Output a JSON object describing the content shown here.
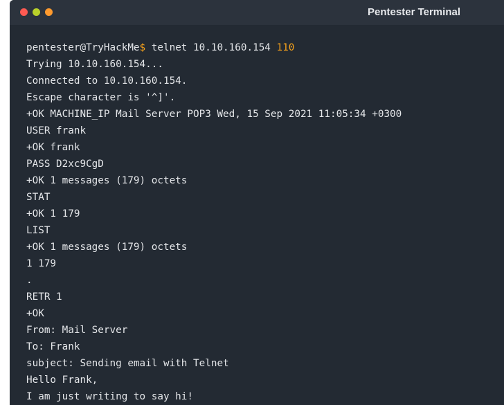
{
  "window": {
    "title": "Pentester Terminal",
    "controls": [
      "close",
      "minimize",
      "maximize"
    ]
  },
  "colors": {
    "background": "#232a33",
    "titlebar": "#2c333d",
    "text": "#e4e6e9",
    "accent": "#f7a21b",
    "close": "#ff5a52",
    "minimize": "#b9d12a",
    "maximize": "#ff9a2e"
  },
  "prompt": {
    "user_host": "pentester@TryHackMe",
    "symbol": "$",
    "command": " telnet 10.10.160.154 ",
    "port": "110"
  },
  "output": [
    "Trying 10.10.160.154...",
    "Connected to 10.10.160.154.",
    "Escape character is '^]'.",
    "+OK MACHINE_IP Mail Server POP3 Wed, 15 Sep 2021 11:05:34 +0300",
    "USER frank",
    "+OK frank",
    "PASS D2xc9CgD",
    "+OK 1 messages (179) octets",
    "STAT",
    "+OK 1 179",
    "LIST",
    "+OK 1 messages (179) octets",
    "1 179",
    ".",
    "RETR 1",
    "+OK",
    "From: Mail Server",
    "To: Frank",
    "subject: Sending email with Telnet",
    "Hello Frank,",
    "I am just writing to say hi!"
  ]
}
